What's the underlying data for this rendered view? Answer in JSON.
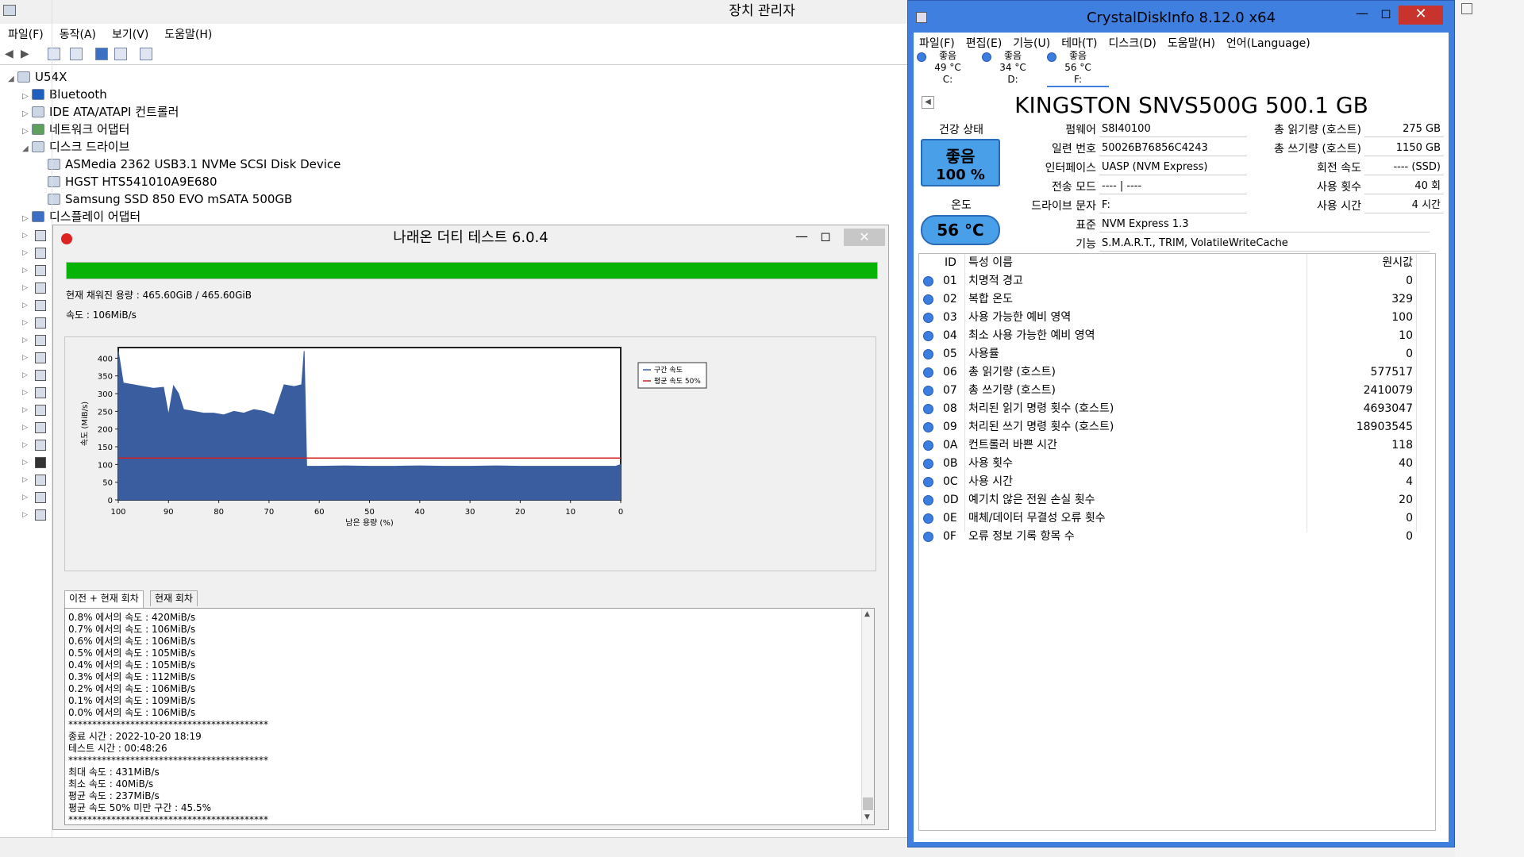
{
  "device_manager": {
    "title": "장치 관리자",
    "menu": [
      "파일(F)",
      "동작(A)",
      "보기(V)",
      "도움말(H)"
    ],
    "root": "U54X",
    "tree": [
      {
        "label": "Bluetooth",
        "icon": "bluetooth-icon"
      },
      {
        "label": "IDE ATA/ATAPI 컨트롤러",
        "icon": "ide-controller-icon"
      },
      {
        "label": "네트워크 어댑터",
        "icon": "network-adapter-icon"
      },
      {
        "label": "디스크 드라이브",
        "icon": "disk-drive-icon"
      },
      {
        "label": "ASMedia 2362 USB3.1 NVMe SCSI Disk Device",
        "icon": "disk-icon"
      },
      {
        "label": "HGST HTS541010A9E680",
        "icon": "disk-icon"
      },
      {
        "label": "Samsung SSD 850 EVO mSATA 500GB",
        "icon": "disk-icon"
      },
      {
        "label": "디스플레이 어댑터",
        "icon": "display-adapter-icon"
      }
    ]
  },
  "dirty_test": {
    "title": "나래온 더티 테스트 6.0.4",
    "progress": 1.0,
    "capacity_text": "현재 채워진 용량 : 465.60GiB / 465.60GiB",
    "speed_text": "속도 : 106MiB/s",
    "tabs": [
      "이전 + 현재 회차",
      "현재 회차"
    ],
    "log": [
      "0.8% 에서의 속도 : 420MiB/s",
      "0.7% 에서의 속도 : 106MiB/s",
      "0.6% 에서의 속도 : 106MiB/s",
      "0.5% 에서의 속도 : 105MiB/s",
      "0.4% 에서의 속도 : 105MiB/s",
      "0.3% 에서의 속도 : 112MiB/s",
      "0.2% 에서의 속도 : 106MiB/s",
      "0.1% 에서의 속도 : 109MiB/s",
      "0.0% 에서의 속도 : 106MiB/s",
      "******************************************",
      "종료 시간 : 2022-10-20 18:19",
      "테스트 시간 : 00:48:26",
      "******************************************",
      "최대 속도 : 431MiB/s",
      "최소 속도 : 40MiB/s",
      "평균 속도 : 237MiB/s",
      "평균 속도 50% 미만 구간 : 45.5%",
      "******************************************"
    ]
  },
  "chart_data": {
    "type": "area",
    "xlabel": "남은 용량 (%)",
    "ylabel": "속도 (MiB/s)",
    "xlim": [
      100,
      0
    ],
    "ylim": [
      0,
      430
    ],
    "xticks": [
      100,
      90,
      80,
      70,
      60,
      50,
      40,
      30,
      20,
      10,
      0
    ],
    "yticks": [
      0,
      50,
      100,
      150,
      200,
      250,
      300,
      350,
      400
    ],
    "legend_position": "top-right",
    "series": [
      {
        "name": "구간 속도",
        "color": "#3a5da0",
        "x": [
          100,
          99,
          97,
          95,
          93,
          91,
          90,
          89,
          88,
          87,
          85,
          83,
          81,
          79,
          77,
          75,
          73,
          71,
          69,
          67,
          65,
          63.5,
          63,
          62.5,
          60,
          55,
          50,
          45,
          40,
          35,
          30,
          25,
          20,
          15,
          10,
          5,
          1,
          0
        ],
        "y": [
          420,
          330,
          325,
          320,
          315,
          318,
          240,
          322,
          300,
          255,
          250,
          245,
          245,
          240,
          250,
          245,
          255,
          250,
          240,
          325,
          320,
          325,
          420,
          95,
          95,
          96,
          95,
          95,
          96,
          95,
          95,
          96,
          95,
          95,
          95,
          95,
          95,
          100
        ]
      },
      {
        "name": "평균 속도 50%",
        "color": "#d22020",
        "y_const": 118
      }
    ]
  },
  "crystaldiskinfo": {
    "title": "CrystalDiskInfo 8.12.0 x64",
    "menu": [
      "파일(F)",
      "편집(E)",
      "기능(U)",
      "테마(T)",
      "디스크(D)",
      "도움말(H)",
      "언어(Language)"
    ],
    "drives": [
      {
        "status": "좋음",
        "temp": "49 °C",
        "letter": "C:"
      },
      {
        "status": "좋음",
        "temp": "34 °C",
        "letter": "D:"
      },
      {
        "status": "좋음",
        "temp": "56 °C",
        "letter": "F:"
      }
    ],
    "model": "KINGSTON SNVS500G 500.1 GB",
    "health_label": "건강 상태",
    "health_status": "좋음",
    "health_pct": "100 %",
    "temp_label": "온도",
    "temp_value": "56 °C",
    "fields": {
      "firmware_label": "펌웨어",
      "firmware": "S8I40100",
      "serial_label": "일련 번호",
      "serial": "50026B76856C4243",
      "interface_label": "인터페이스",
      "interface": "UASP (NVM Express)",
      "transfer_label": "전송 모드",
      "transfer": "---- | ----",
      "letter_label": "드라이브 문자",
      "letter": "F:",
      "standard_label": "표준",
      "standard": "NVM Express 1.3",
      "features_label": "기능",
      "features": "S.M.A.R.T., TRIM, VolatileWriteCache",
      "read_label": "총 읽기량 (호스트)",
      "read": "275 GB",
      "write_label": "총 쓰기량 (호스트)",
      "write": "1150 GB",
      "rpm_label": "회전 속도",
      "rpm": "---- (SSD)",
      "count_label": "사용 횟수",
      "count": "40 회",
      "hours_label": "사용 시간",
      "hours": "4 시간"
    },
    "smart_header": {
      "id": "ID",
      "name": "특성 이름",
      "raw": "원시값"
    },
    "smart": [
      {
        "id": "01",
        "name": "치명적 경고",
        "raw": "0"
      },
      {
        "id": "02",
        "name": "복합 온도",
        "raw": "329"
      },
      {
        "id": "03",
        "name": "사용 가능한 예비 영역",
        "raw": "100"
      },
      {
        "id": "04",
        "name": "최소 사용 가능한 예비 영역",
        "raw": "10"
      },
      {
        "id": "05",
        "name": "사용률",
        "raw": "0"
      },
      {
        "id": "06",
        "name": "총 읽기량 (호스트)",
        "raw": "577517"
      },
      {
        "id": "07",
        "name": "총 쓰기량 (호스트)",
        "raw": "2410079"
      },
      {
        "id": "08",
        "name": "처리된 읽기 명령 횟수 (호스트)",
        "raw": "4693047"
      },
      {
        "id": "09",
        "name": "처리된 쓰기 명령 횟수 (호스트)",
        "raw": "18903545"
      },
      {
        "id": "0A",
        "name": "컨트롤러 바쁜 시간",
        "raw": "118"
      },
      {
        "id": "0B",
        "name": "사용 횟수",
        "raw": "40"
      },
      {
        "id": "0C",
        "name": "사용 시간",
        "raw": "4"
      },
      {
        "id": "0D",
        "name": "예기치 않은 전원 손실 횟수",
        "raw": "20"
      },
      {
        "id": "0E",
        "name": "매체/데이터 무결성 오류 횟수",
        "raw": "0"
      },
      {
        "id": "0F",
        "name": "오류 정보 기록 항목 수",
        "raw": "0"
      }
    ]
  }
}
